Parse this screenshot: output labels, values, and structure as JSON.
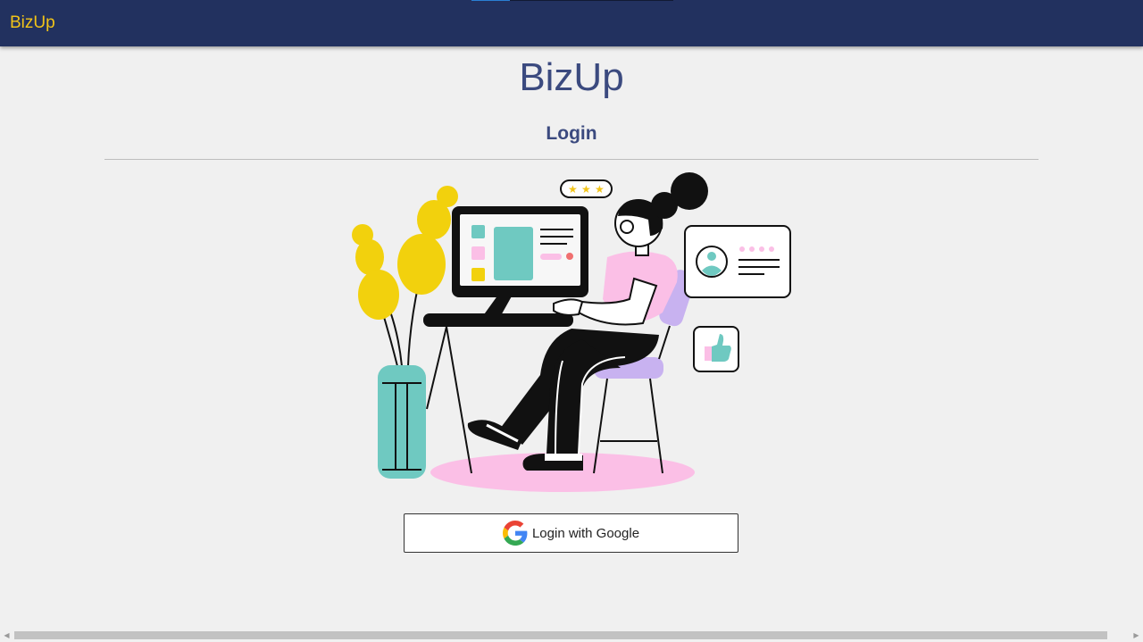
{
  "navbar": {
    "brand": "BizUp",
    "progress_percent": 19
  },
  "page": {
    "title": "BizUp",
    "subtitle": "Login"
  },
  "illustration": {
    "rating_stars": 3
  },
  "login": {
    "google_button_label": "Login with Google",
    "icon": "google-logo-icon"
  },
  "colors": {
    "navbar_bg": "#22315f",
    "brand": "#f2c418",
    "title": "#3b4a7f",
    "teal": "#6fc9c1",
    "pink": "#fbbfe6",
    "yellow": "#f2d10d",
    "lavender": "#c8b2f0"
  }
}
